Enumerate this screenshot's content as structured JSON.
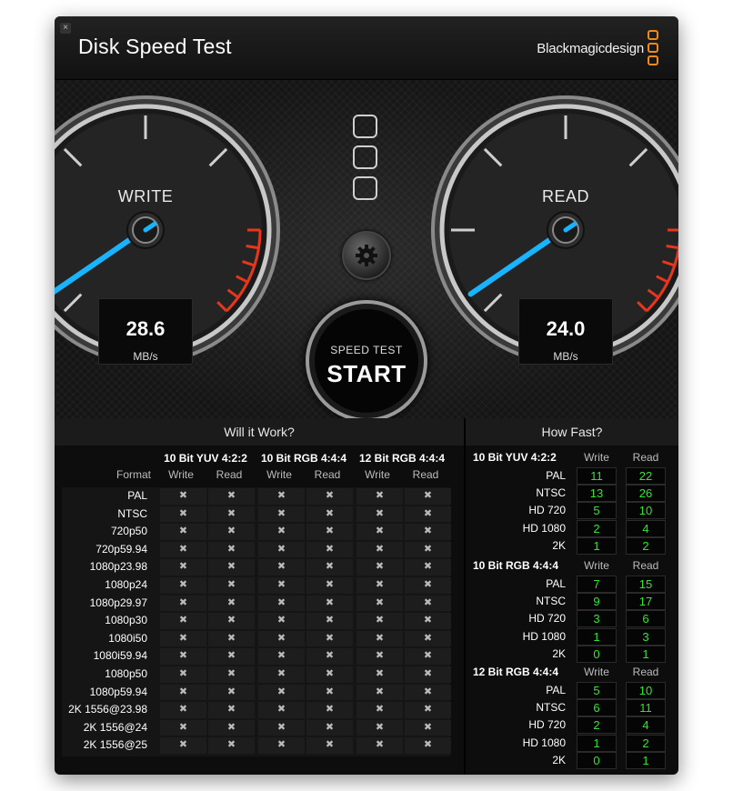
{
  "window": {
    "close_glyph": "×"
  },
  "header": {
    "title": "Disk Speed Test",
    "brand": "Blackmagicdesign"
  },
  "gauges": {
    "write": {
      "label": "WRITE",
      "value": "28.6",
      "unit": "MB/s"
    },
    "read": {
      "label": "READ",
      "value": "24.0",
      "unit": "MB/s"
    }
  },
  "controls": {
    "start_sub": "SPEED TEST",
    "start_main": "START"
  },
  "will_it_work": {
    "title": "Will it Work?",
    "format_label": "Format",
    "groups": [
      "10 Bit YUV 4:2:2",
      "10 Bit RGB 4:4:4",
      "12 Bit RGB 4:4:4"
    ],
    "subcols": [
      "Write",
      "Read",
      "Write",
      "Read",
      "Write",
      "Read"
    ],
    "cross_glyph": "✖",
    "formats": [
      "PAL",
      "NTSC",
      "720p50",
      "720p59.94",
      "1080p23.98",
      "1080p24",
      "1080p29.97",
      "1080p30",
      "1080i50",
      "1080i59.94",
      "1080p50",
      "1080p59.94",
      "2K 1556@23.98",
      "2K 1556@24",
      "2K 1556@25"
    ]
  },
  "how_fast": {
    "title": "How Fast?",
    "write_label": "Write",
    "read_label": "Read",
    "groups": [
      {
        "name": "10 Bit YUV 4:2:2",
        "rows": [
          {
            "label": "PAL",
            "write": "11",
            "read": "22"
          },
          {
            "label": "NTSC",
            "write": "13",
            "read": "26"
          },
          {
            "label": "HD 720",
            "write": "5",
            "read": "10"
          },
          {
            "label": "HD 1080",
            "write": "2",
            "read": "4"
          },
          {
            "label": "2K",
            "write": "1",
            "read": "2"
          }
        ]
      },
      {
        "name": "10 Bit RGB 4:4:4",
        "rows": [
          {
            "label": "PAL",
            "write": "7",
            "read": "15"
          },
          {
            "label": "NTSC",
            "write": "9",
            "read": "17"
          },
          {
            "label": "HD 720",
            "write": "3",
            "read": "6"
          },
          {
            "label": "HD 1080",
            "write": "1",
            "read": "3"
          },
          {
            "label": "2K",
            "write": "0",
            "read": "1"
          }
        ]
      },
      {
        "name": "12 Bit RGB 4:4:4",
        "rows": [
          {
            "label": "PAL",
            "write": "5",
            "read": "10"
          },
          {
            "label": "NTSC",
            "write": "6",
            "read": "11"
          },
          {
            "label": "HD 720",
            "write": "2",
            "read": "4"
          },
          {
            "label": "HD 1080",
            "write": "1",
            "read": "2"
          },
          {
            "label": "2K",
            "write": "0",
            "read": "1"
          }
        ]
      }
    ]
  },
  "colors": {
    "needle": "#19b4ff",
    "redline": "#e8361a",
    "value_green": "#2ee82e",
    "brand_orange": "#f08a1c"
  },
  "icons": {
    "settings": "gear-icon",
    "close": "close-icon",
    "cross": "cross-icon"
  }
}
